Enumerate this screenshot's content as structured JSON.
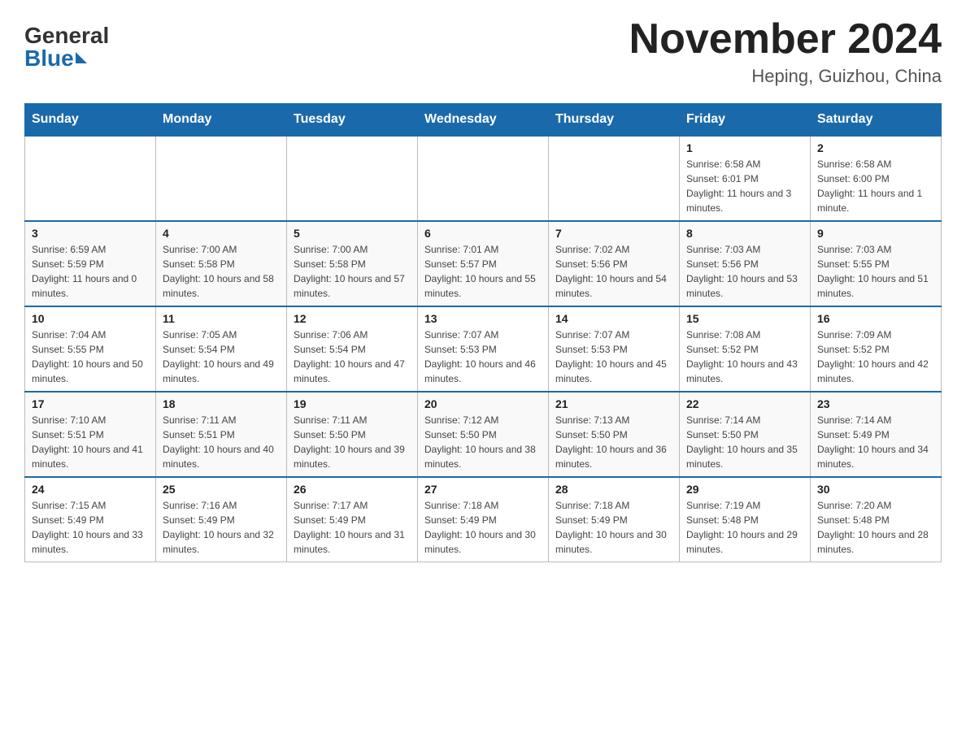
{
  "header": {
    "logo_general": "General",
    "logo_blue": "Blue",
    "month_title": "November 2024",
    "location": "Heping, Guizhou, China"
  },
  "columns": [
    "Sunday",
    "Monday",
    "Tuesday",
    "Wednesday",
    "Thursday",
    "Friday",
    "Saturday"
  ],
  "weeks": [
    [
      {
        "day": "",
        "info": ""
      },
      {
        "day": "",
        "info": ""
      },
      {
        "day": "",
        "info": ""
      },
      {
        "day": "",
        "info": ""
      },
      {
        "day": "",
        "info": ""
      },
      {
        "day": "1",
        "info": "Sunrise: 6:58 AM\nSunset: 6:01 PM\nDaylight: 11 hours and 3 minutes."
      },
      {
        "day": "2",
        "info": "Sunrise: 6:58 AM\nSunset: 6:00 PM\nDaylight: 11 hours and 1 minute."
      }
    ],
    [
      {
        "day": "3",
        "info": "Sunrise: 6:59 AM\nSunset: 5:59 PM\nDaylight: 11 hours and 0 minutes."
      },
      {
        "day": "4",
        "info": "Sunrise: 7:00 AM\nSunset: 5:58 PM\nDaylight: 10 hours and 58 minutes."
      },
      {
        "day": "5",
        "info": "Sunrise: 7:00 AM\nSunset: 5:58 PM\nDaylight: 10 hours and 57 minutes."
      },
      {
        "day": "6",
        "info": "Sunrise: 7:01 AM\nSunset: 5:57 PM\nDaylight: 10 hours and 55 minutes."
      },
      {
        "day": "7",
        "info": "Sunrise: 7:02 AM\nSunset: 5:56 PM\nDaylight: 10 hours and 54 minutes."
      },
      {
        "day": "8",
        "info": "Sunrise: 7:03 AM\nSunset: 5:56 PM\nDaylight: 10 hours and 53 minutes."
      },
      {
        "day": "9",
        "info": "Sunrise: 7:03 AM\nSunset: 5:55 PM\nDaylight: 10 hours and 51 minutes."
      }
    ],
    [
      {
        "day": "10",
        "info": "Sunrise: 7:04 AM\nSunset: 5:55 PM\nDaylight: 10 hours and 50 minutes."
      },
      {
        "day": "11",
        "info": "Sunrise: 7:05 AM\nSunset: 5:54 PM\nDaylight: 10 hours and 49 minutes."
      },
      {
        "day": "12",
        "info": "Sunrise: 7:06 AM\nSunset: 5:54 PM\nDaylight: 10 hours and 47 minutes."
      },
      {
        "day": "13",
        "info": "Sunrise: 7:07 AM\nSunset: 5:53 PM\nDaylight: 10 hours and 46 minutes."
      },
      {
        "day": "14",
        "info": "Sunrise: 7:07 AM\nSunset: 5:53 PM\nDaylight: 10 hours and 45 minutes."
      },
      {
        "day": "15",
        "info": "Sunrise: 7:08 AM\nSunset: 5:52 PM\nDaylight: 10 hours and 43 minutes."
      },
      {
        "day": "16",
        "info": "Sunrise: 7:09 AM\nSunset: 5:52 PM\nDaylight: 10 hours and 42 minutes."
      }
    ],
    [
      {
        "day": "17",
        "info": "Sunrise: 7:10 AM\nSunset: 5:51 PM\nDaylight: 10 hours and 41 minutes."
      },
      {
        "day": "18",
        "info": "Sunrise: 7:11 AM\nSunset: 5:51 PM\nDaylight: 10 hours and 40 minutes."
      },
      {
        "day": "19",
        "info": "Sunrise: 7:11 AM\nSunset: 5:50 PM\nDaylight: 10 hours and 39 minutes."
      },
      {
        "day": "20",
        "info": "Sunrise: 7:12 AM\nSunset: 5:50 PM\nDaylight: 10 hours and 38 minutes."
      },
      {
        "day": "21",
        "info": "Sunrise: 7:13 AM\nSunset: 5:50 PM\nDaylight: 10 hours and 36 minutes."
      },
      {
        "day": "22",
        "info": "Sunrise: 7:14 AM\nSunset: 5:50 PM\nDaylight: 10 hours and 35 minutes."
      },
      {
        "day": "23",
        "info": "Sunrise: 7:14 AM\nSunset: 5:49 PM\nDaylight: 10 hours and 34 minutes."
      }
    ],
    [
      {
        "day": "24",
        "info": "Sunrise: 7:15 AM\nSunset: 5:49 PM\nDaylight: 10 hours and 33 minutes."
      },
      {
        "day": "25",
        "info": "Sunrise: 7:16 AM\nSunset: 5:49 PM\nDaylight: 10 hours and 32 minutes."
      },
      {
        "day": "26",
        "info": "Sunrise: 7:17 AM\nSunset: 5:49 PM\nDaylight: 10 hours and 31 minutes."
      },
      {
        "day": "27",
        "info": "Sunrise: 7:18 AM\nSunset: 5:49 PM\nDaylight: 10 hours and 30 minutes."
      },
      {
        "day": "28",
        "info": "Sunrise: 7:18 AM\nSunset: 5:49 PM\nDaylight: 10 hours and 30 minutes."
      },
      {
        "day": "29",
        "info": "Sunrise: 7:19 AM\nSunset: 5:48 PM\nDaylight: 10 hours and 29 minutes."
      },
      {
        "day": "30",
        "info": "Sunrise: 7:20 AM\nSunset: 5:48 PM\nDaylight: 10 hours and 28 minutes."
      }
    ]
  ]
}
